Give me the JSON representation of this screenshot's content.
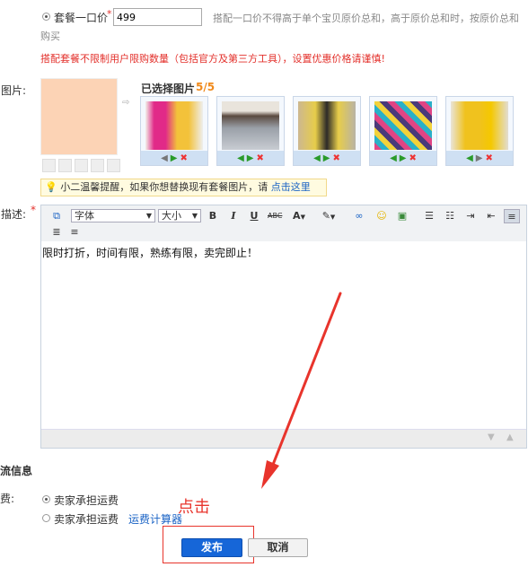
{
  "price": {
    "label": "套餐一口价",
    "required_mark": "*",
    "value": "499",
    "hint_line1": "搭配一口价不得高于单个宝贝原价总和，高于原价总和时，按原价总和",
    "hint_line2": "购买"
  },
  "warning": "搭配套餐不限制用户限购数量（包括官方及第三方工具），设置优惠价格请谨慎!",
  "images": {
    "label": "图片:",
    "selected_label": "已选择图片",
    "selected_count": "5/5",
    "thumbs": [
      {
        "name": "product-image-1"
      },
      {
        "name": "product-image-2"
      },
      {
        "name": "product-image-3"
      },
      {
        "name": "product-image-4"
      },
      {
        "name": "product-image-5"
      }
    ],
    "tip_text": "小二温馨提醒，如果你想替换现有套餐图片，请",
    "tip_link": "点击这里"
  },
  "description": {
    "label": "描述:",
    "required_mark": "*",
    "font_select": "字体",
    "size_select": "大小",
    "content": "限时打折，时间有限，熟练有限，卖完即止！"
  },
  "logistics": {
    "section_title": "物流信息",
    "fee_label": "运费:",
    "option1": "卖家承担运费",
    "option2": "卖家承担运费",
    "calculator_link": "运费计算器"
  },
  "annotation": {
    "text": "点击",
    "color": "#e8342c"
  },
  "actions": {
    "publish": "发布",
    "cancel": "取消"
  },
  "colors": {
    "warning": "#e3302b",
    "link": "#1a63c5",
    "accent_orange": "#f08a1c",
    "publish_bg": "#1666d8"
  }
}
